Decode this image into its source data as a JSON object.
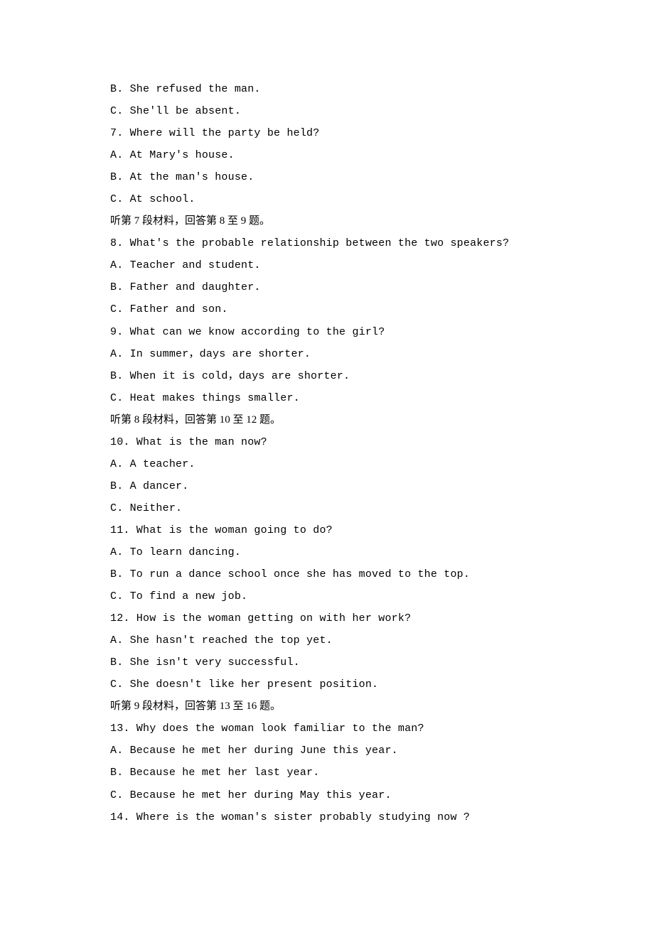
{
  "lines": [
    "B. She refused the man.",
    "C. She'll be absent.",
    "7. Where will the party be held?",
    "A. At Mary's house.",
    "B. At the man's house.",
    "C. At school.",
    "听第 7 段材料，回答第 8 至 9 题。",
    "8. What's the probable relationship between the two speakers?",
    "A. Teacher and student.",
    "B. Father and daughter.",
    "C. Father and son.",
    "9. What can we know according to the girl?",
    "A. In summer，days are shorter.",
    "B. When it is cold，days are shorter.",
    "C. Heat makes things smaller.",
    "听第 8 段材料，回答第 10 至 12 题。",
    "10. What is the man now?",
    "A. A teacher.",
    "B. A dancer.",
    "C. Neither.",
    "11. What is the woman going to do?",
    "A. To learn dancing.",
    "B. To run a dance school once she has moved to the top.",
    "C. To find a new job.",
    "12. How is the woman getting on with her work?",
    "A. She hasn't reached the top yet.",
    "B. She isn't very successful.",
    "C. She doesn't like her present position.",
    "听第 9 段材料，回答第 13 至 16 题。",
    "13. Why does the woman look familiar to the man?",
    "A. Because he met her during June this year.",
    "B. Because he met her last year.",
    "C. Because he met her during May this year.",
    "14. Where is the woman's sister probably studying now ?"
  ]
}
